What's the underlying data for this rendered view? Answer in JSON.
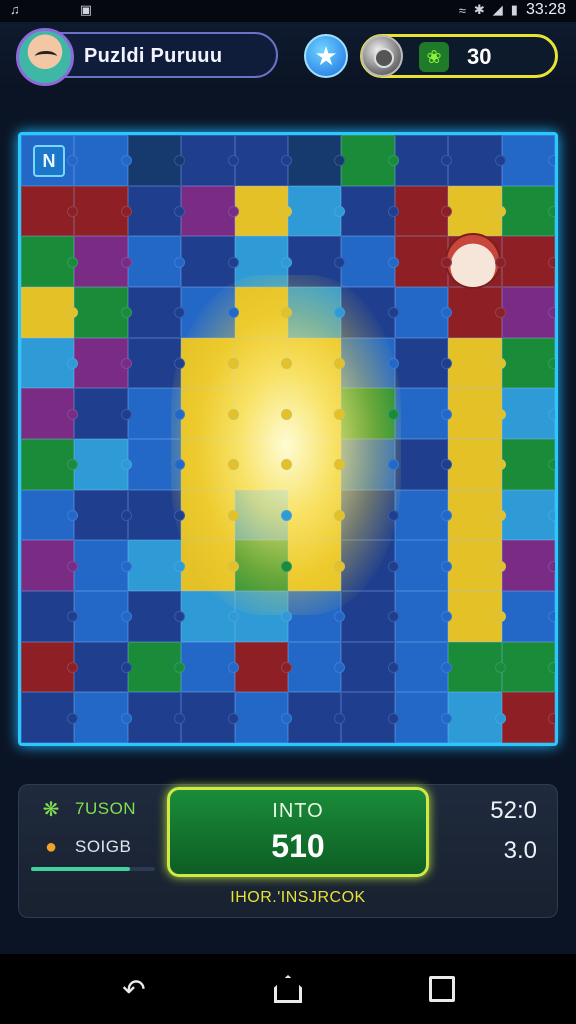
{
  "status_bar": {
    "time": "33:28",
    "icons": [
      "app-notification-icon",
      "screenshot-icon",
      "wifi-icon",
      "bluetooth-icon",
      "signal-icon",
      "battery-icon"
    ]
  },
  "header": {
    "title": "Puzldi Puruuu",
    "coins": "30",
    "icons": [
      "avatar",
      "star-icon",
      "coin-icon",
      "gem-icon"
    ],
    "accent_color": "#e9e332"
  },
  "board": {
    "border_color": "#28c9ff",
    "corner_icon": "N",
    "palette": [
      "#1f3f8e",
      "#2468c7",
      "#1a8c39",
      "#7a2b84",
      "#8e1f25",
      "#e4c227",
      "#2f9bd6",
      "#173a6e"
    ]
  },
  "panel": {
    "stat_1_label": "7USON",
    "stat_2_label": "SOIGB",
    "progress": 0.8,
    "center_label": "INTO",
    "center_value": "510",
    "footer_text": "IHOR.'INSJRCOK",
    "right_value_1": "52:0",
    "right_value_2": "3.0"
  },
  "navbar": {
    "back_icon": "back-icon",
    "home_icon": "home-icon",
    "recents_icon": "recents-icon"
  }
}
